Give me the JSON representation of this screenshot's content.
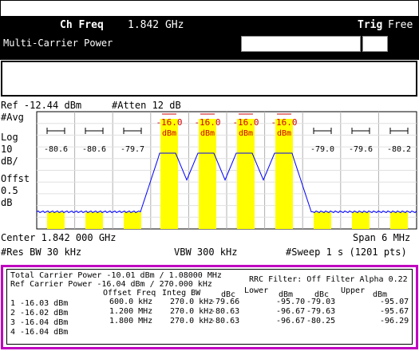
{
  "header": {
    "ch_freq_label": "Ch Freq",
    "ch_freq_value": "1.842 GHz",
    "trig_label": "Trig",
    "trig_value": "Free",
    "measurement": "Multi-Carrier Power"
  },
  "settings": {
    "ref_level": "Ref -12.44 dBm",
    "atten": "#Atten 12 dB",
    "avg": "#Avg",
    "scale_lines": [
      "Log",
      "10",
      "dB/",
      "Offst",
      "0.5",
      "dB"
    ],
    "center": "Center 1.842 000 GHz",
    "span": "Span 6 MHz",
    "res_bw": "#Res BW 30 kHz",
    "vbw": "VBW 300 kHz",
    "sweep": "#Sweep 1 s (1201 pts)"
  },
  "chart_data": {
    "type": "spectrum",
    "carrier_labels": [
      "-16.0",
      "-16.0",
      "-16.0",
      "-16.0"
    ],
    "carrier_units": [
      "dBm",
      "dBm",
      "dBm",
      "dBm"
    ],
    "offset_labels_left": [
      "-80.6",
      "-80.6",
      "-79.7"
    ],
    "offset_labels_right": [
      "-79.0",
      "-79.6",
      "-80.2"
    ],
    "colors": {
      "trace": "#0000ff",
      "carrier_fill": "#ffff00",
      "marker": "#d00000",
      "border": "#c000c0"
    }
  },
  "results": {
    "total_line": "Total Carrier Power -10.01 dBm / 1.08000 MHz",
    "ref_line": "Ref Carrier Power   -16.04 dBm / 270.000 kHz",
    "rrc": "RRC Filter: Off  Filter Alpha  0.22",
    "col_offset": "Offset Freq",
    "col_integ": "Integ BW",
    "col_dbc1": "dBc",
    "col_lower": "Lower",
    "col_dbm1": "dBm",
    "col_dbc2": "dBc",
    "col_upper": "Upper",
    "col_dbm2": "dBm",
    "carriers": [
      "1  -16.03 dBm",
      "2  -16.02 dBm",
      "3  -16.04 dBm",
      "4  -16.04 dBm"
    ],
    "rows": [
      {
        "offset": "600.0 kHz",
        "integ": "270.0 kHz",
        "lower_dbc": "-79.66",
        "lower_dbm": "-95.70",
        "upper_dbc": "-79.03",
        "upper_dbm": "-95.07"
      },
      {
        "offset": "1.200 MHz",
        "integ": "270.0 kHz",
        "lower_dbc": "-80.63",
        "lower_dbm": "-96.67",
        "upper_dbc": "-79.63",
        "upper_dbm": "-95.67"
      },
      {
        "offset": "1.800 MHz",
        "integ": "270.0 kHz",
        "lower_dbc": "-80.63",
        "lower_dbm": "-96.67",
        "upper_dbc": "-80.25",
        "upper_dbm": "-96.29"
      }
    ]
  }
}
